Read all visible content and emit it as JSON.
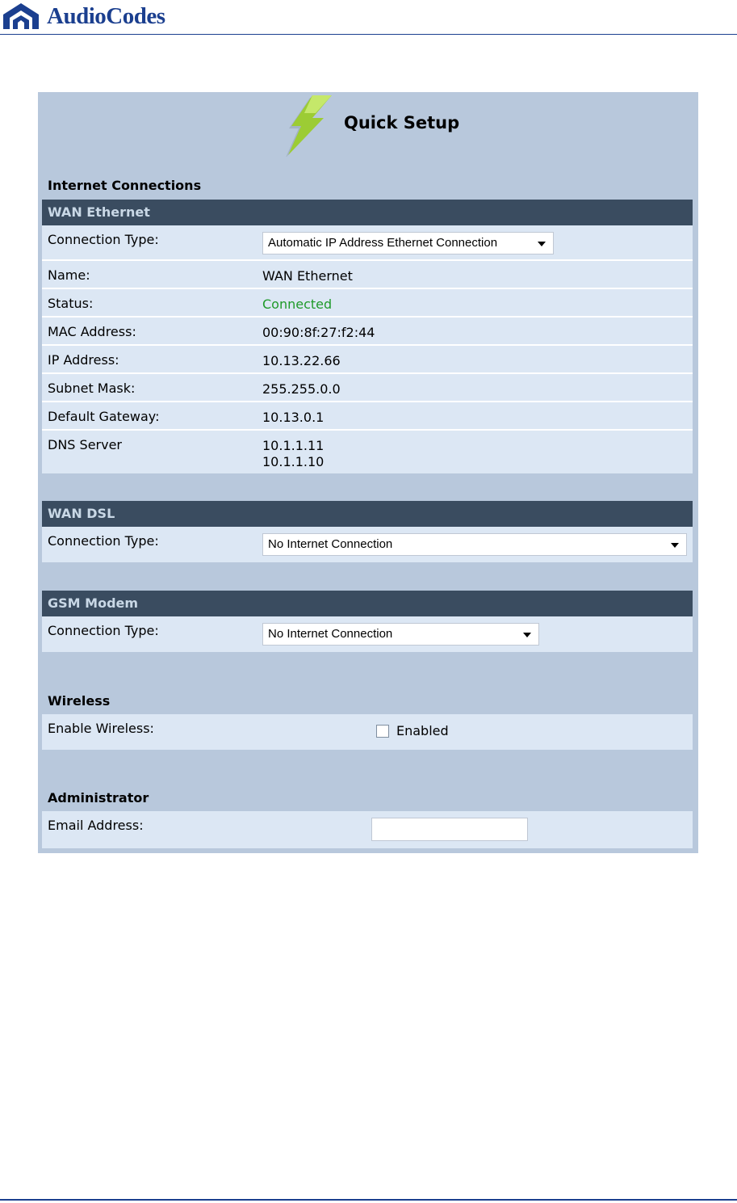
{
  "brand": {
    "name": "AudioCodes",
    "color": "#1b3f8f"
  },
  "page": {
    "title": "Quick Setup"
  },
  "internet_connections": {
    "heading": "Internet Connections",
    "wan_ethernet": {
      "title": "WAN Ethernet",
      "connection_type_label": "Connection Type:",
      "connection_type_value": "Automatic IP Address Ethernet Connection",
      "name_label": "Name:",
      "name_value": "WAN Ethernet",
      "status_label": "Status:",
      "status_value": "Connected",
      "mac_label": "MAC Address:",
      "mac_value": "00:90:8f:27:f2:44",
      "ip_label": "IP Address:",
      "ip_value": "10.13.22.66",
      "subnet_label": "Subnet Mask:",
      "subnet_value": "255.255.0.0",
      "gateway_label": "Default Gateway:",
      "gateway_value": "10.13.0.1",
      "dns_label": "DNS Server",
      "dns_values": [
        "10.1.1.11",
        "10.1.1.10"
      ]
    },
    "wan_dsl": {
      "title": "WAN DSL",
      "connection_type_label": "Connection Type:",
      "connection_type_value": "No Internet Connection"
    },
    "gsm_modem": {
      "title": "GSM Modem",
      "connection_type_label": "Connection Type:",
      "connection_type_value": "No Internet Connection"
    }
  },
  "wireless": {
    "heading": "Wireless",
    "enable_label": "Enable Wireless:",
    "enabled_label": "Enabled",
    "enabled_checked": false
  },
  "administrator": {
    "heading": "Administrator",
    "email_label": "Email Address:",
    "email_value": ""
  },
  "colors": {
    "status_connected": "#1f9a2a",
    "table_header": "#3a4c60",
    "panel_bg": "#b8c8dc",
    "row_bg": "#dce7f4"
  }
}
